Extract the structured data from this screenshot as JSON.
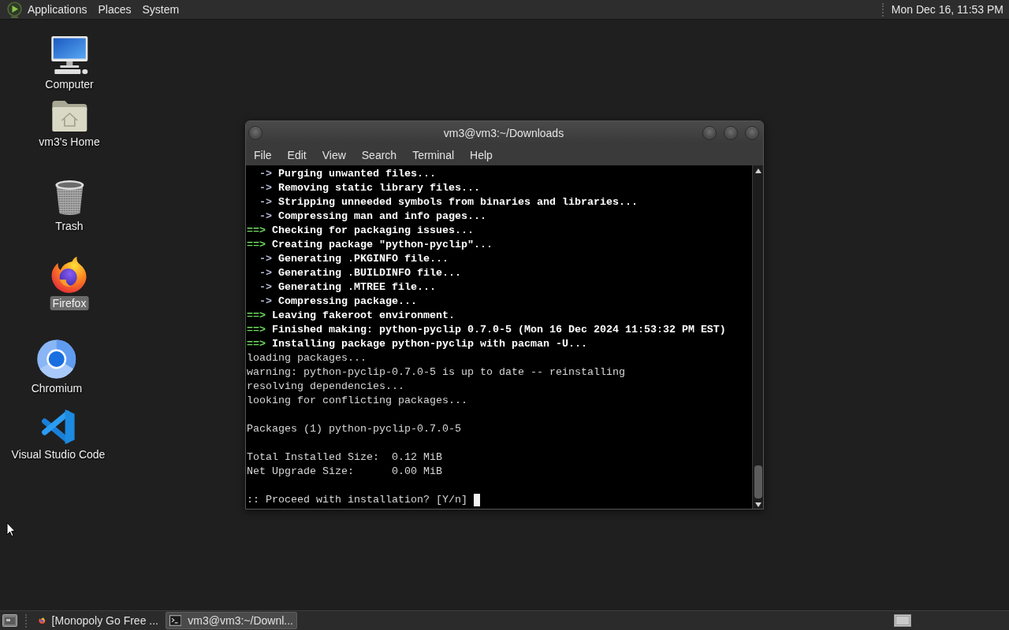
{
  "top_panel": {
    "menus": [
      "Applications",
      "Places",
      "System"
    ],
    "clock": "Mon Dec 16, 11:53 PM"
  },
  "desktop_icons": [
    {
      "kind": "computer",
      "label": "Computer",
      "selected": false
    },
    {
      "kind": "home",
      "label": "vm3's Home",
      "selected": false
    },
    {
      "kind": "trash",
      "label": "Trash",
      "selected": false
    },
    {
      "kind": "browser",
      "label": "Firefox",
      "selected": true
    },
    {
      "kind": "chromium",
      "label": "Chromium",
      "selected": false
    },
    {
      "kind": "editor",
      "label": "Visual Studio Code",
      "selected": false
    }
  ],
  "terminal": {
    "title": "vm3@vm3:~/Downloads",
    "menu": [
      "File",
      "Edit",
      "View",
      "Search",
      "Terminal",
      "Help"
    ],
    "lines": [
      {
        "kind": "step",
        "marker": "->",
        "text": "Purging unwanted files..."
      },
      {
        "kind": "step",
        "marker": "->",
        "text": "Removing static library files..."
      },
      {
        "kind": "step",
        "marker": "->",
        "text": "Stripping unneeded symbols from binaries and libraries..."
      },
      {
        "kind": "step",
        "marker": "->",
        "text": "Compressing man and info pages..."
      },
      {
        "kind": "stage",
        "marker": "==>",
        "text": "Checking for packaging issues..."
      },
      {
        "kind": "stage",
        "marker": "==>",
        "text": "Creating package \"python-pyclip\"..."
      },
      {
        "kind": "step",
        "marker": "->",
        "text": "Generating .PKGINFO file..."
      },
      {
        "kind": "step",
        "marker": "->",
        "text": "Generating .BUILDINFO file..."
      },
      {
        "kind": "step",
        "marker": "->",
        "text": "Generating .MTREE file..."
      },
      {
        "kind": "step",
        "marker": "->",
        "text": "Compressing package..."
      },
      {
        "kind": "stage",
        "marker": "==>",
        "text": "Leaving fakeroot environment."
      },
      {
        "kind": "stage",
        "marker": "==>",
        "text": "Finished making: python-pyclip 0.7.0-5 (Mon 16 Dec 2024 11:53:32 PM EST)"
      },
      {
        "kind": "stage",
        "marker": "==>",
        "text": "Installing package python-pyclip with pacman -U..."
      },
      {
        "kind": "output",
        "text": "loading packages..."
      },
      {
        "kind": "output",
        "text": "warning: python-pyclip-0.7.0-5 is up to date -- reinstalling"
      },
      {
        "kind": "output",
        "text": "resolving dependencies..."
      },
      {
        "kind": "output",
        "text": "looking for conflicting packages..."
      },
      {
        "kind": "blank"
      },
      {
        "kind": "output",
        "text": "Packages (1) python-pyclip-0.7.0-5"
      },
      {
        "kind": "blank"
      },
      {
        "kind": "output",
        "text": "Total Installed Size:  0.12 MiB"
      },
      {
        "kind": "output",
        "text": "Net Upgrade Size:      0.00 MiB"
      },
      {
        "kind": "blank"
      },
      {
        "kind": "prompt",
        "text": ":: Proceed with installation? [Y/n]"
      }
    ]
  },
  "taskbar": {
    "items": [
      {
        "kind": "browser",
        "label": "[Monopoly Go Free ...",
        "selected": false
      },
      {
        "kind": "terminal",
        "label": "vm3@vm3:~/Downl...",
        "selected": true
      }
    ]
  }
}
